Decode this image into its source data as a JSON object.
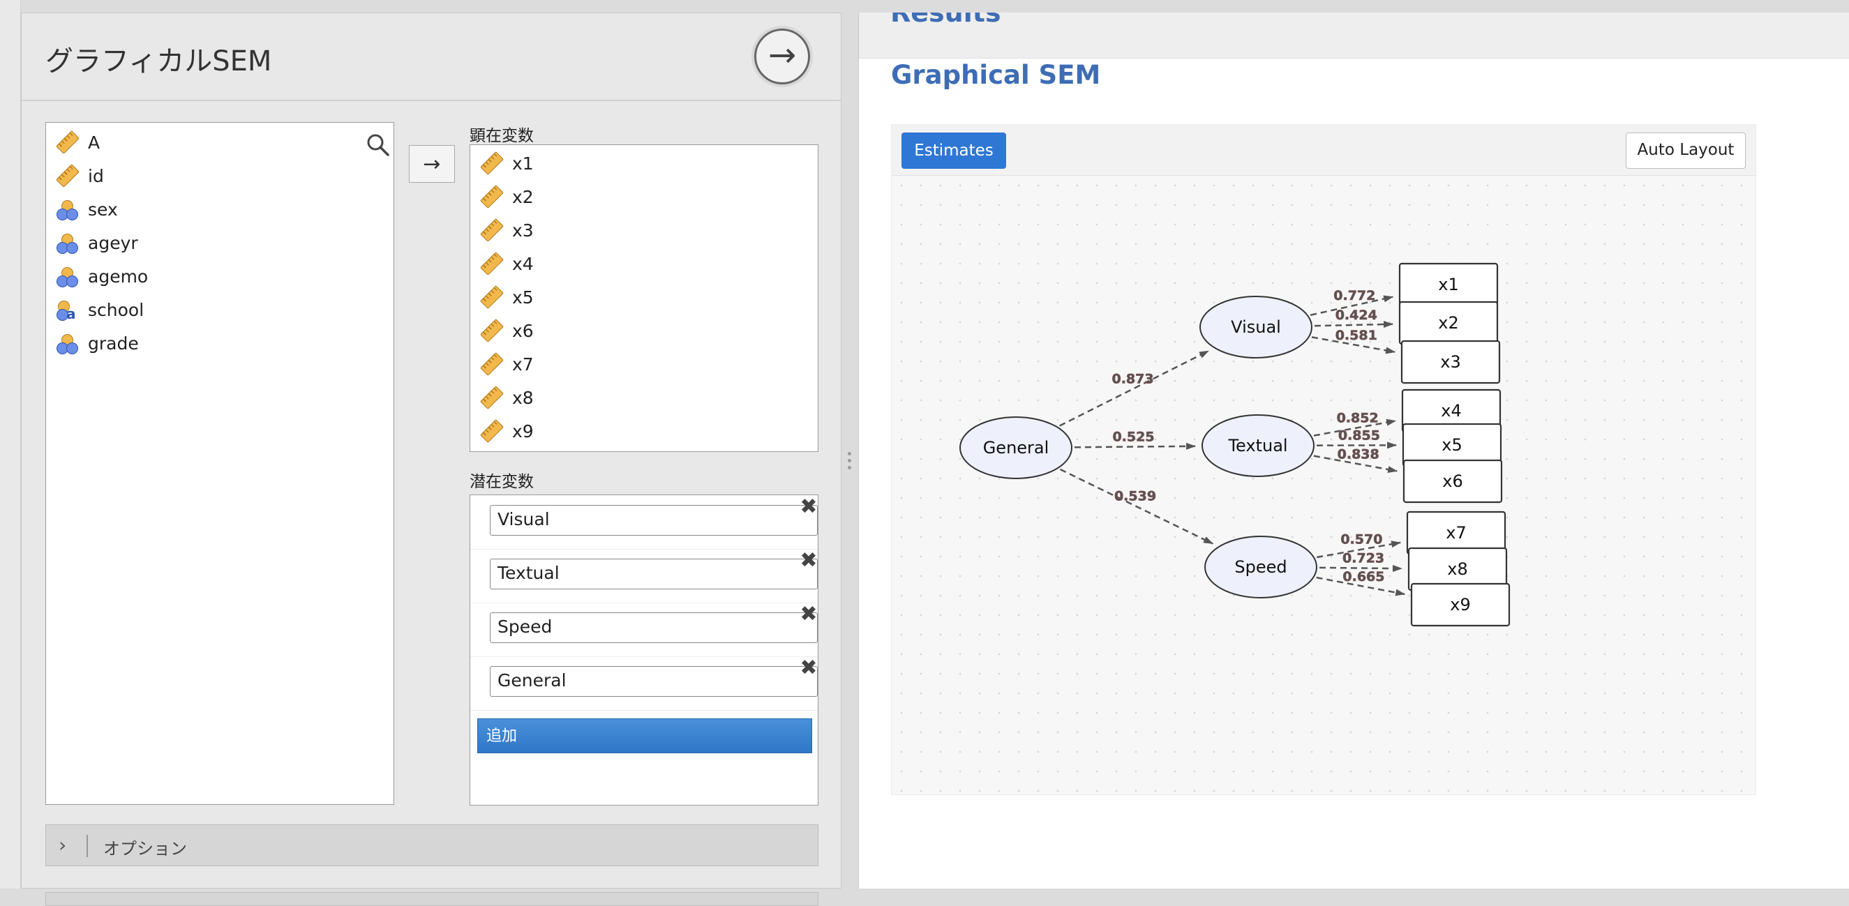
{
  "analysis": {
    "title": "グラフィカルSEM",
    "run_icon": "arrow-right-circle-icon",
    "assign_icon": "arrow-right-icon",
    "variables": [
      {
        "name": "A",
        "type": "measure"
      },
      {
        "name": "id",
        "type": "measure"
      },
      {
        "name": "sex",
        "type": "nominal"
      },
      {
        "name": "ageyr",
        "type": "nominal"
      },
      {
        "name": "agemo",
        "type": "nominal"
      },
      {
        "name": "school",
        "type": "nominal-text"
      },
      {
        "name": "grade",
        "type": "nominal"
      }
    ],
    "manifest_label": "顕在変数",
    "manifest": [
      "x1",
      "x2",
      "x3",
      "x4",
      "x5",
      "x6",
      "x7",
      "x8",
      "x9"
    ],
    "latent_label": "潜在変数",
    "latent": [
      "Visual",
      "Textual",
      "Speed",
      "General"
    ],
    "add_label": "追加",
    "options_label": "オプション"
  },
  "results": {
    "heading": "Results",
    "title": "Graphical SEM",
    "estimates_label": "Estimates",
    "auto_layout_label": "Auto Layout"
  },
  "sem": {
    "latent_nodes": [
      "General",
      "Visual",
      "Textual",
      "Speed"
    ],
    "observed_nodes": [
      "x1",
      "x2",
      "x3",
      "x4",
      "x5",
      "x6",
      "x7",
      "x8",
      "x9"
    ],
    "paths": [
      {
        "from": "General",
        "to": "Visual",
        "estimate": "0.873"
      },
      {
        "from": "General",
        "to": "Textual",
        "estimate": "0.525"
      },
      {
        "from": "General",
        "to": "Speed",
        "estimate": "0.539"
      },
      {
        "from": "Visual",
        "to": "x1",
        "estimate": "0.772"
      },
      {
        "from": "Visual",
        "to": "x2",
        "estimate": "0.424"
      },
      {
        "from": "Visual",
        "to": "x3",
        "estimate": "0.581"
      },
      {
        "from": "Textual",
        "to": "x4",
        "estimate": "0.852"
      },
      {
        "from": "Textual",
        "to": "x5",
        "estimate": "0.855"
      },
      {
        "from": "Textual",
        "to": "x6",
        "estimate": "0.838"
      },
      {
        "from": "Speed",
        "to": "x7",
        "estimate": "0.570"
      },
      {
        "from": "Speed",
        "to": "x8",
        "estimate": "0.723"
      },
      {
        "from": "Speed",
        "to": "x9",
        "estimate": "0.665"
      }
    ]
  }
}
